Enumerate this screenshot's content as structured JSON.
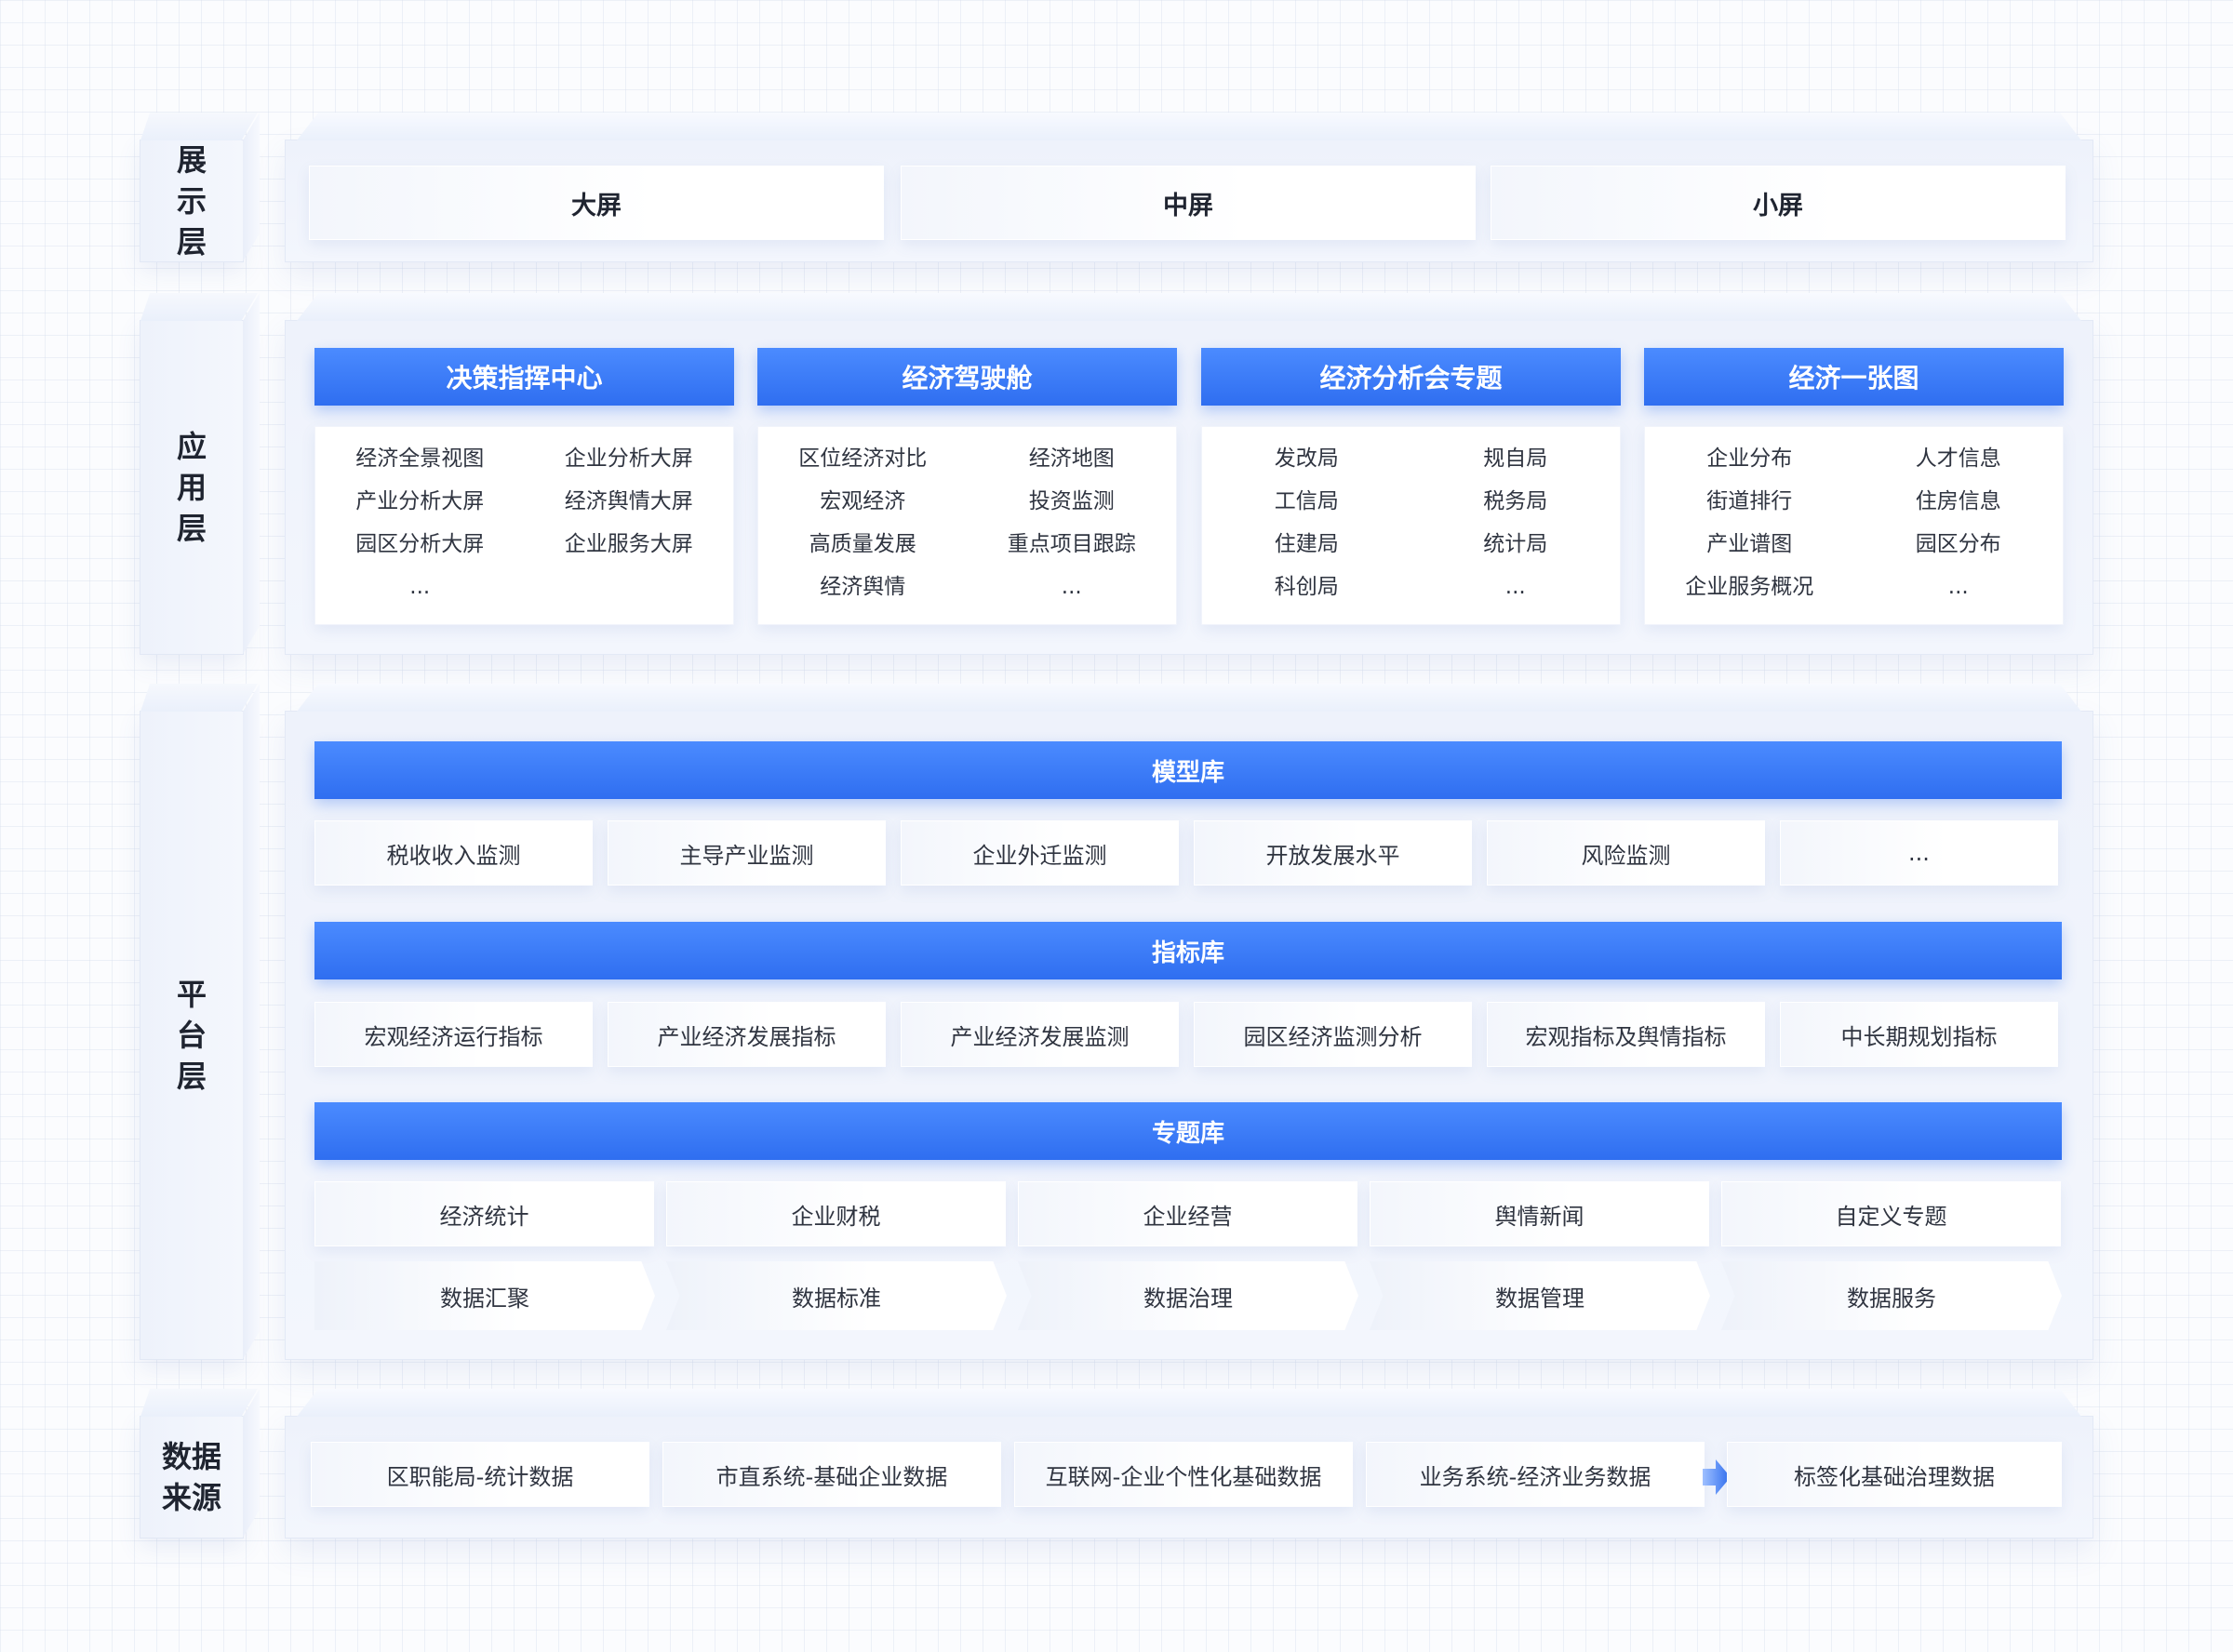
{
  "layers": {
    "display": "展示层",
    "application": "应用层",
    "platform": "平台层",
    "data_source_line1": "数据",
    "data_source_line2": "来源"
  },
  "display": {
    "screens": [
      "大屏",
      "中屏",
      "小屏"
    ]
  },
  "application": {
    "modules": [
      {
        "title": "决策指挥中心",
        "left": [
          "经济全景视图",
          "产业分析大屏",
          "园区分析大屏",
          "..."
        ],
        "right": [
          "企业分析大屏",
          "经济舆情大屏",
          "企业服务大屏",
          ""
        ]
      },
      {
        "title": "经济驾驶舱",
        "left": [
          "区位经济对比",
          "宏观经济",
          "高质量发展",
          "经济舆情"
        ],
        "right": [
          "经济地图",
          "投资监测",
          "重点项目跟踪",
          "..."
        ]
      },
      {
        "title": "经济分析会专题",
        "left": [
          "发改局",
          "工信局",
          "住建局",
          "科创局"
        ],
        "right": [
          "规自局",
          "税务局",
          "统计局",
          "..."
        ]
      },
      {
        "title": "经济一张图",
        "left": [
          "企业分布",
          "街道排行",
          "产业谱图",
          "企业服务概况"
        ],
        "right": [
          "人才信息",
          "住房信息",
          "园区分布",
          "..."
        ]
      }
    ]
  },
  "platform": {
    "model_lib": {
      "title": "模型库",
      "items": [
        "税收收入监测",
        "主导产业监测",
        "企业外迁监测",
        "开放发展水平",
        "风险监测",
        "..."
      ]
    },
    "indicator_lib": {
      "title": "指标库",
      "items": [
        "宏观经济运行指标",
        "产业经济发展指标",
        "产业经济发展监测",
        "园区经济监测分析",
        "宏观指标及舆情指标",
        "中长期规划指标"
      ]
    },
    "topic_lib": {
      "title": "专题库",
      "items": [
        "经济统计",
        "企业财税",
        "企业经营",
        "舆情新闻",
        "自定义专题"
      ]
    },
    "process": [
      "数据汇聚",
      "数据标准",
      "数据治理",
      "数据管理",
      "数据服务"
    ]
  },
  "data_source": {
    "items": [
      "区职能局-统计数据",
      "市直系统-基础企业数据",
      "互联网-企业个性化基础数据",
      "业务系统-经济业务数据"
    ],
    "result": "标签化基础治理数据"
  },
  "colors": {
    "accent": "#2f6ef0",
    "accent_light": "#4b8bff",
    "panel_bg": "#eef2fb"
  }
}
